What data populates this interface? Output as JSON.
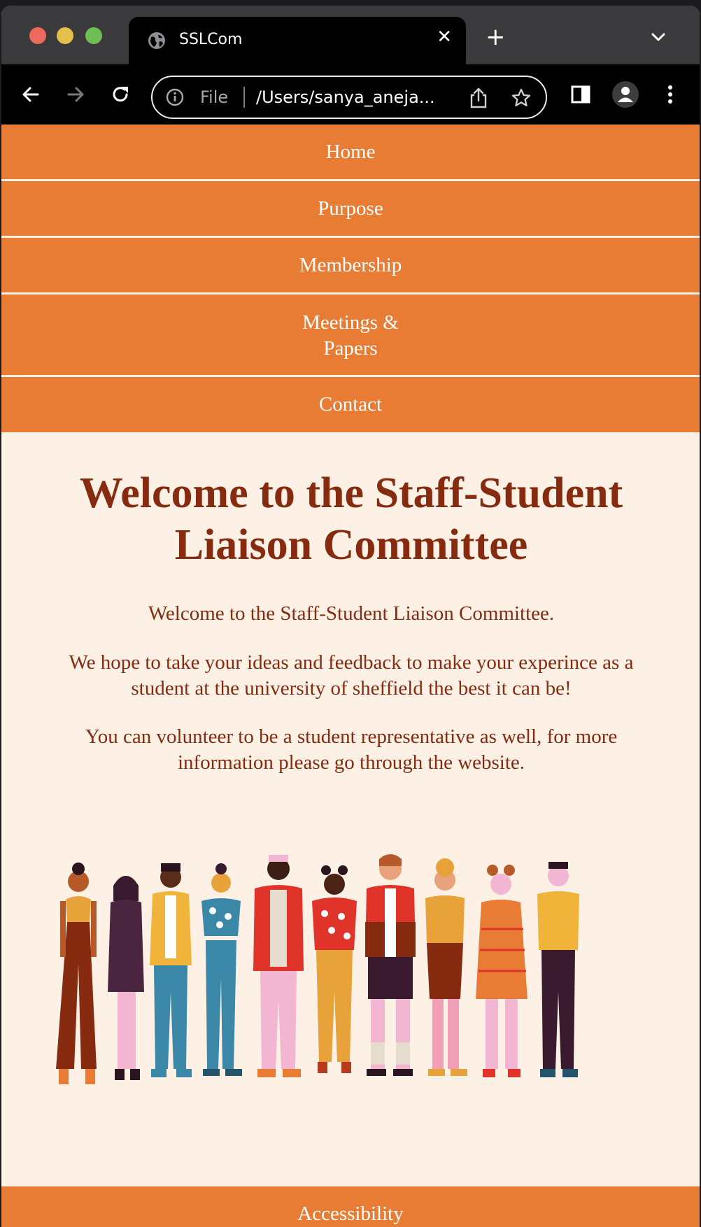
{
  "browser": {
    "tab_title": "SSLCom",
    "omnibox_scheme": "File",
    "omnibox_url": "/Users/sanya_aneja..."
  },
  "nav": {
    "home": "Home",
    "purpose": "Purpose",
    "membership": "Membership",
    "meetings_line1": "Meetings &",
    "meetings_line2": "Papers",
    "contact": "Contact"
  },
  "main": {
    "heading_line1": "Welcome to the Staff-Student",
    "heading_line2": "Liaison Committee",
    "intro": "Welcome to the Staff-Student Liaison Committee.",
    "para2_line1": "We hope to take your ideas and feedback to make your experince as a",
    "para2_line2": "student at the university of sheffield the best it can be!",
    "para3_line1": "You can volunteer to be a student representative as well, for more",
    "para3_line2": "information please go through the website."
  },
  "footer": {
    "accessibility": "Accessibility"
  },
  "colors": {
    "nav_bg": "#e97c34",
    "page_bg": "#fdf1e5",
    "text": "#862a10"
  }
}
